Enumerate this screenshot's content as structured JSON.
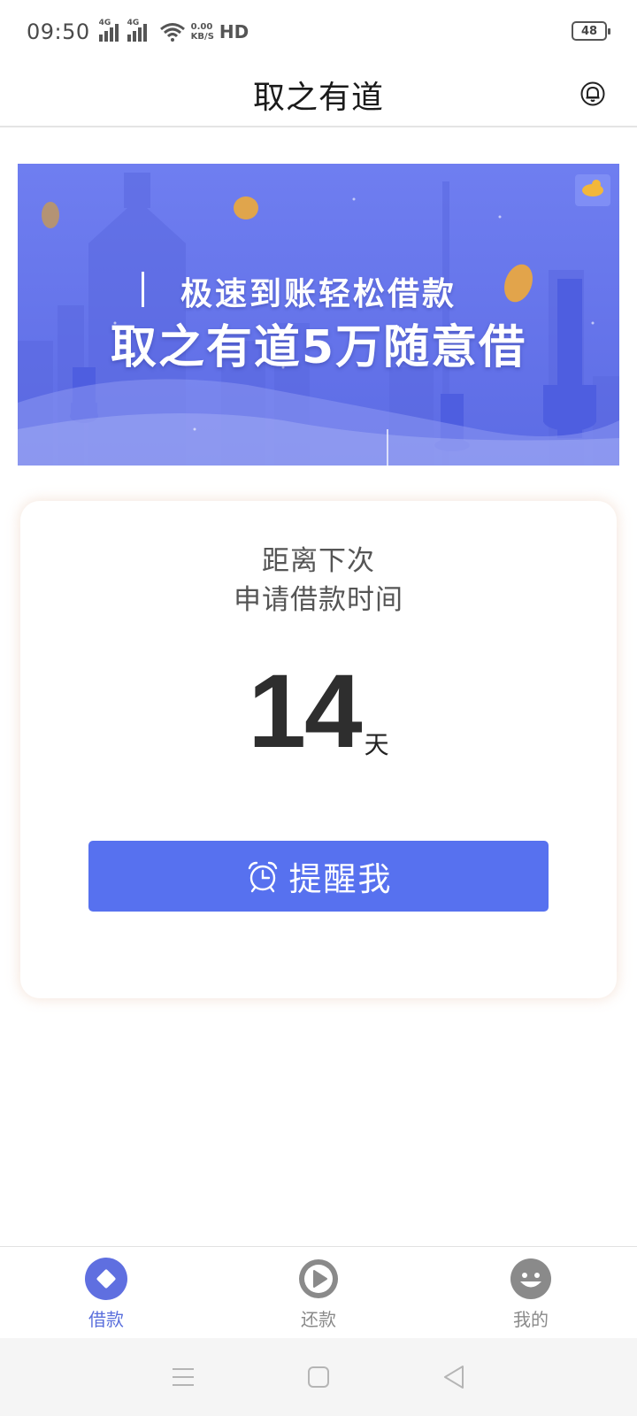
{
  "status_bar": {
    "time": "09:50",
    "signal1_label": "4G",
    "signal2_label": "4G",
    "speed_value": "0.00",
    "speed_unit": "KB/S",
    "hd_label": "HD",
    "battery": "48"
  },
  "header": {
    "title": "取之有道",
    "bell_icon": "bell-icon"
  },
  "banner": {
    "line1": "极速到账轻松借款",
    "line2": "取之有道5万随意借"
  },
  "card": {
    "caption_line1": "距离下次",
    "caption_line2": "申请借款时间",
    "countdown_value": "14",
    "countdown_unit": "天",
    "remind_button_label": "提醒我",
    "remind_icon": "alarm-clock-icon"
  },
  "tabbar": {
    "items": [
      {
        "label": "借款",
        "icon": "diamond-icon",
        "active": true
      },
      {
        "label": "还款",
        "icon": "play-icon",
        "active": false
      },
      {
        "label": "我的",
        "icon": "smiley-icon",
        "active": false
      }
    ]
  },
  "colors": {
    "accent": "#5771EF",
    "tab_active": "#5A6FDC",
    "tab_inactive": "#8A8A8A",
    "banner_bg": "#6574EA"
  }
}
